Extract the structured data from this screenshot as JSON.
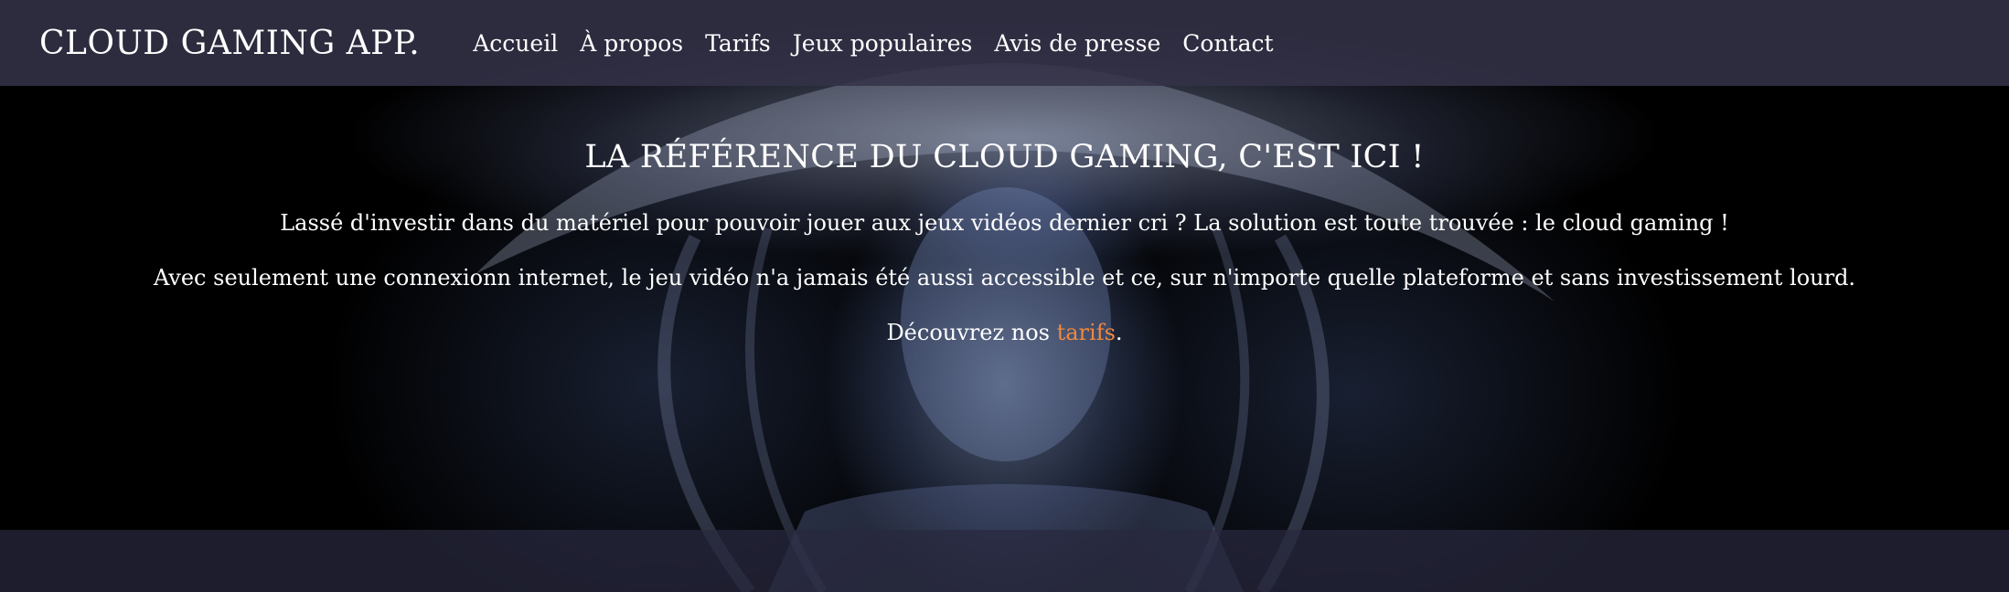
{
  "brand": "CLOUD GAMING APP.",
  "nav": {
    "items": [
      {
        "label": "Accueil"
      },
      {
        "label": "À propos"
      },
      {
        "label": "Tarifs"
      },
      {
        "label": "Jeux populaires"
      },
      {
        "label": "Avis de presse"
      },
      {
        "label": "Contact"
      }
    ]
  },
  "hero": {
    "title": "LA RÉFÉRENCE DU CLOUD GAMING, C'EST ICI !",
    "paragraph_1": "Lassé d'investir dans du matériel pour pouvoir jouer aux jeux vidéos dernier cri ? La solution est toute trouvée : le cloud gaming !",
    "paragraph_2": "Avec seulement une connexionn internet, le jeu vidéo n'a jamais été aussi accessible et ce, sur n'importe quelle plateforme et sans investissement lourd.",
    "cta_prefix": "Découvrez nos ",
    "cta_link": "tarifs",
    "cta_suffix": "."
  },
  "colors": {
    "navbar_bg": "#343248",
    "link_accent": "#f0883e",
    "text": "#ffffff"
  }
}
